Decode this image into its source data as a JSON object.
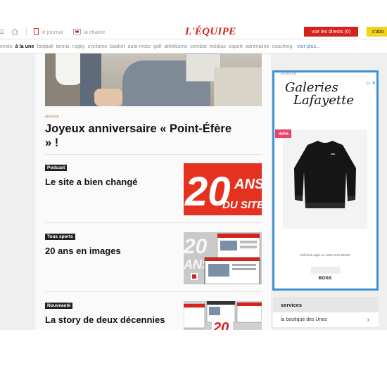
{
  "header": {
    "journal_label": "le journal",
    "chaine_label": "la chaîne",
    "logo_text": "L'ÉQUIPE",
    "directs_label": "voir les directs (0)",
    "abonner_label": "s'abo"
  },
  "nav": {
    "items": [
      "onnés",
      "à la une",
      "football",
      "tennis",
      "rugby",
      "cyclisme",
      "basket",
      "auto-moto",
      "golf",
      "athlétisme",
      "combat",
      "médias",
      "esport",
      "adrénaline",
      "coaching"
    ],
    "more_label": "voir plus..."
  },
  "hero": {
    "label": "abonné",
    "title": "Joyeux anniversaire « Point-Éfère » !"
  },
  "articles": [
    {
      "tag": "Podcast",
      "title": "Le site a bien changé",
      "thumb_text": [
        "20",
        "ANS",
        "DU SITE"
      ]
    },
    {
      "tag": "Tous sports",
      "title": "20 ans en images",
      "thumb_text": [
        "20",
        "ANS"
      ]
    },
    {
      "tag": "Nouveauté",
      "title": "La story de deux décennies",
      "thumb_text": [
        "20"
      ]
    }
  ],
  "ad": {
    "label": "publicité",
    "logo_lines": [
      "Galeries",
      "Lafayette"
    ],
    "discount": "-64%",
    "caption": "Pull droit siglé en coton Noir BOSS",
    "brand": "BOSS"
  },
  "services": {
    "title": "services",
    "item": "la boutique des Unes"
  },
  "colors": {
    "brand_red": "#d6221c",
    "accent_yellow": "#f2d21c",
    "ad_border": "#3f92d2",
    "discount_pink": "#e8446b"
  }
}
